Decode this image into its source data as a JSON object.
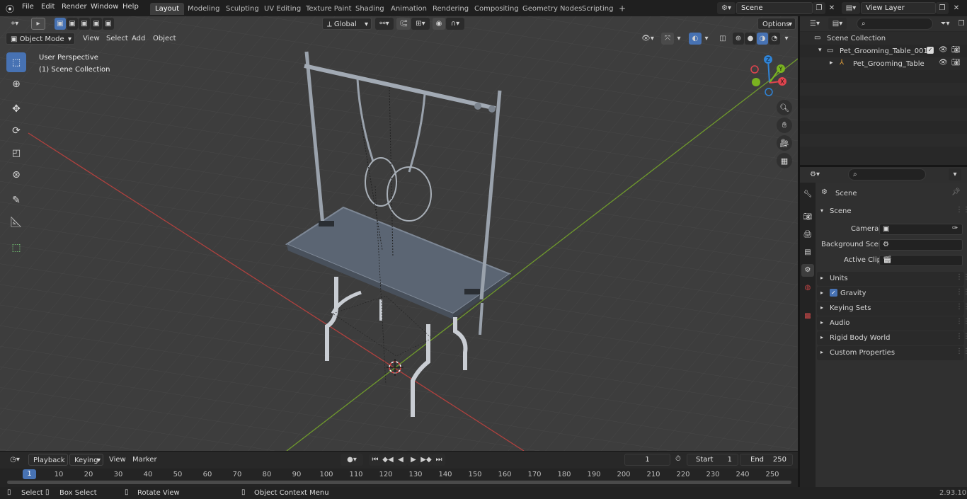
{
  "topbar": {
    "menus": [
      "File",
      "Edit",
      "Render",
      "Window",
      "Help"
    ],
    "workspaces": [
      "Layout",
      "Modeling",
      "Sculpting",
      "UV Editing",
      "Texture Paint",
      "Shading",
      "Animation",
      "Rendering",
      "Compositing",
      "Geometry Nodes",
      "Scripting"
    ],
    "active_workspace": "Layout",
    "add_tab": "+",
    "scene_name": "Scene",
    "view_layer": "View Layer"
  },
  "viewport_header": {
    "transform_orientation": "Global",
    "options": "Options",
    "mode": "Object Mode",
    "menus": [
      "View",
      "Select",
      "Add",
      "Object"
    ]
  },
  "viewport": {
    "perspective_label": "User Perspective",
    "collection_label": "(1) Scene Collection",
    "axis_x": "X",
    "axis_y": "Y",
    "axis_z": "Z"
  },
  "outliner": {
    "root": "Scene Collection",
    "items": [
      {
        "label": "Pet_Grooming_Table_001"
      },
      {
        "label": "Pet_Grooming_Table"
      }
    ]
  },
  "properties": {
    "breadcrumb": "Scene",
    "section": "Scene",
    "fields": [
      {
        "label": "Camera"
      },
      {
        "label": "Background Scene"
      },
      {
        "label": "Active Clip"
      }
    ],
    "panels": [
      "Units",
      "Gravity",
      "Keying Sets",
      "Audio",
      "Rigid Body World",
      "Custom Properties"
    ]
  },
  "timeline": {
    "menus": [
      "Playback",
      "Keying",
      "View",
      "Marker"
    ],
    "current_frame": "1",
    "start_label": "Start",
    "start": "1",
    "end_label": "End",
    "end": "250",
    "ticks": [
      "1",
      "10",
      "20",
      "30",
      "40",
      "50",
      "60",
      "70",
      "80",
      "90",
      "100",
      "110",
      "120",
      "130",
      "140",
      "150",
      "160",
      "170",
      "180",
      "190",
      "200",
      "210",
      "220",
      "230",
      "240",
      "250"
    ]
  },
  "statusbar": {
    "select": "Select",
    "box_select": "Box Select",
    "rotate_view": "Rotate View",
    "context_menu": "Object Context Menu",
    "version": "2.93.10"
  },
  "colors": {
    "accent": "#4772b3",
    "x_axis": "#e0444e",
    "y_axis": "#7ab320",
    "z_axis": "#2f83d6"
  }
}
